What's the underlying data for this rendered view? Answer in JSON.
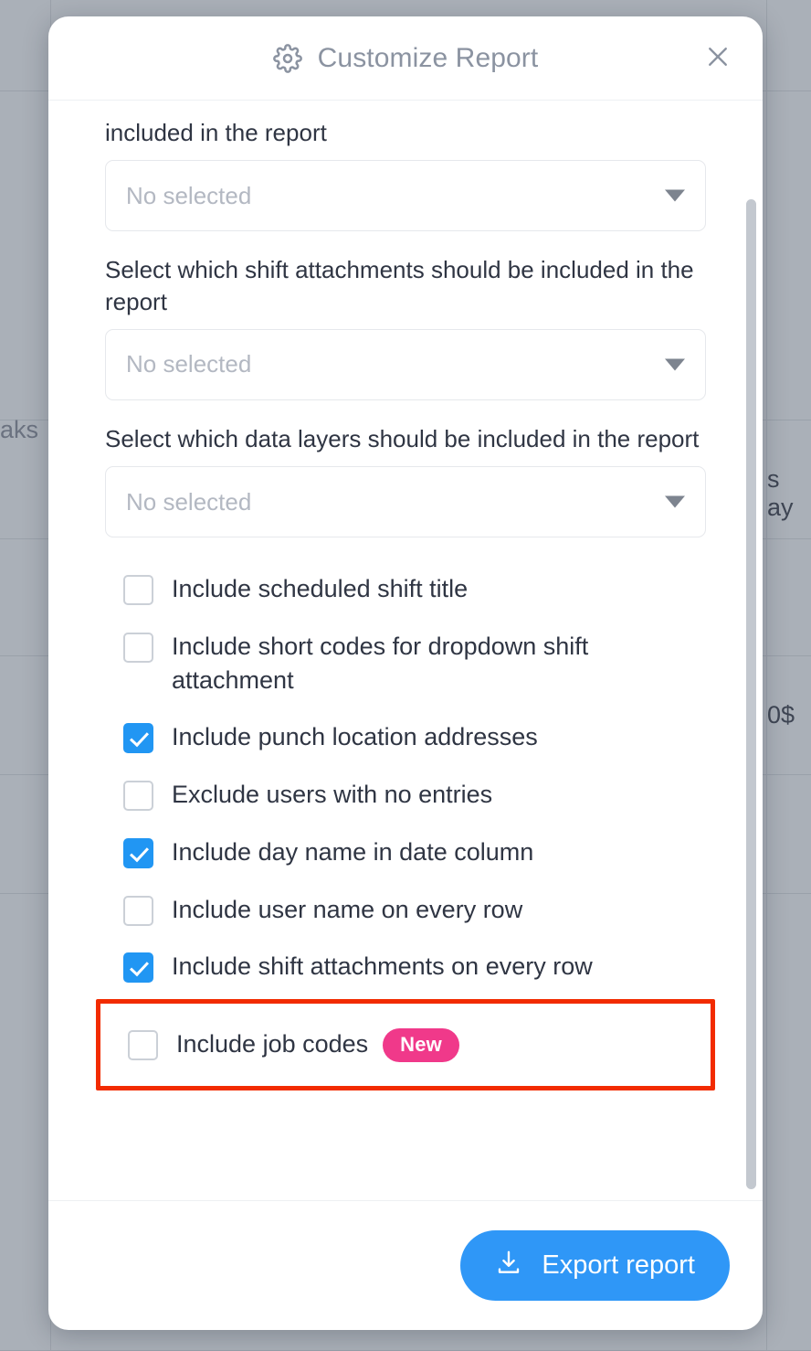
{
  "modal": {
    "title": "Customize Report",
    "gear_icon": "gear-icon",
    "close_icon": "close-icon"
  },
  "fields": [
    {
      "label": "included in the report",
      "value": "No selected",
      "arrow_icon": "chevron-down-icon"
    },
    {
      "label": "Select which shift attachments should be included in the report",
      "value": "No selected",
      "arrow_icon": "chevron-down-icon"
    },
    {
      "label": "Select which data layers should be included in the report",
      "value": "No selected",
      "arrow_icon": "chevron-down-icon"
    }
  ],
  "checkboxes": [
    {
      "label": "Include scheduled shift title",
      "checked": false,
      "badge": null,
      "highlighted": false
    },
    {
      "label": "Include short codes for dropdown shift attachment",
      "checked": false,
      "badge": null,
      "highlighted": false
    },
    {
      "label": "Include punch location addresses",
      "checked": true,
      "badge": null,
      "highlighted": false
    },
    {
      "label": "Exclude users with no entries",
      "checked": false,
      "badge": null,
      "highlighted": false
    },
    {
      "label": "Include day name in date column",
      "checked": true,
      "badge": null,
      "highlighted": false
    },
    {
      "label": "Include user name on every row",
      "checked": false,
      "badge": null,
      "highlighted": false
    },
    {
      "label": "Include shift attachments on every row",
      "checked": true,
      "badge": null,
      "highlighted": false
    },
    {
      "label": "Include job codes",
      "checked": false,
      "badge": "New",
      "highlighted": true
    }
  ],
  "footer": {
    "export_label": "Export report",
    "download_icon": "download-icon"
  },
  "background": {
    "left_fragments": [
      "",
      "aks",
      "",
      "",
      "",
      "",
      ""
    ],
    "right_fragments": [
      "",
      "ay",
      "s",
      "",
      "0$",
      "",
      ""
    ]
  },
  "colors": {
    "accent_blue": "#2196f3",
    "button_blue": "#2f97f7",
    "badge_pink": "#f0398a",
    "highlight_red": "#f22b00",
    "title_gray": "#8b93a1",
    "text_dark": "#2f3543",
    "placeholder_gray": "#b3b8c2",
    "backdrop_gray": "#aab0b8"
  }
}
